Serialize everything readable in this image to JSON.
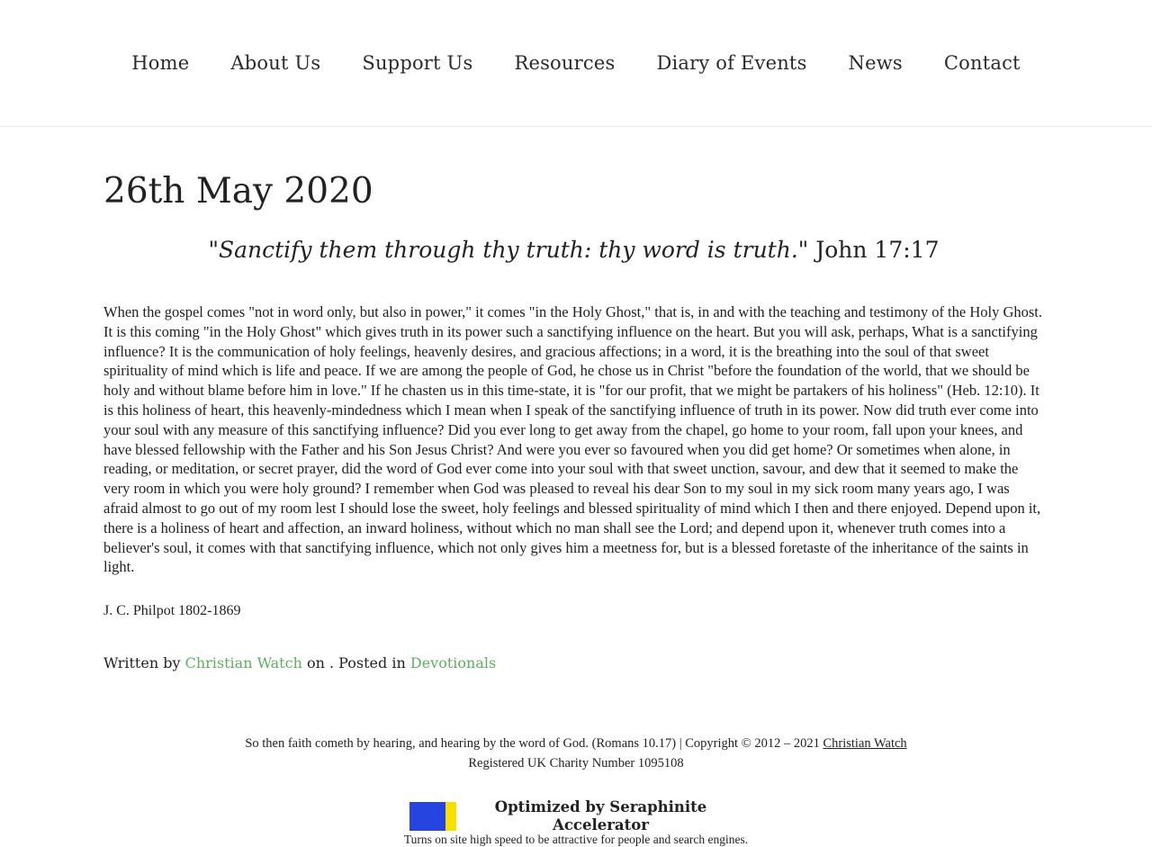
{
  "nav": {
    "items": [
      {
        "label": "Home"
      },
      {
        "label": "About Us"
      },
      {
        "label": "Support Us"
      },
      {
        "label": "Resources"
      },
      {
        "label": "Diary of Events"
      },
      {
        "label": "News"
      },
      {
        "label": "Contact"
      }
    ]
  },
  "post": {
    "title": "26th May 2020",
    "verse_quote": "\"Sanctify them through thy truth: thy word is truth.\"",
    "verse_ref": " John 17:17",
    "body": "When the gospel comes \"not in word only, but also in power,\" it comes \"in the Holy Ghost,\" that is, in and with the teaching and testimony of the Holy Ghost. It is this coming \"in the Holy Ghost\" which gives truth in its power such a sanctifying influence on the heart. But you will ask, perhaps, What is a sanctifying influence? It is the communication of holy feelings, heavenly desires, and gracious affections; in a word, it is the breathing into the soul of that sweet spirituality of mind which is life and peace. If we are among the people of God, he chose us in Christ \"before the foundation of the world, that we should be holy and without blame before him in love.\" If he chasten us in this time-state, it is \"for our profit, that we might be partakers of his holiness\" (Heb. 12:10). It is this holiness of heart, this heavenly-mindedness which I mean when I speak of the sanctifying influence of truth in its power. Now did truth ever come into your soul with any measure of this sanctifying influence? Did you ever long to get away from the chapel, go home to your room, fall upon your knees, and have blessed fellowship with the Father and his Son Jesus Christ? And were you ever so favoured when you did get home? Or sometimes when alone, in reading, or meditation, or secret prayer, did the word of God ever come into your soul with that sweet unction, savour, and dew that it seemed to make the very room in which you were holy ground? I remember when God was pleased to reveal his dear Son to my soul in my sick room many years ago, I was afraid almost to go out of my room lest I should lose the sweet, holy feelings and blessed spirituality of mind which I then and there enjoyed. Depend upon it, there is a holiness of heart and affection, an inward holiness, without which no man shall see the Lord; and depend upon it, whenever truth comes into a believer's soul, it comes with that sanctifying influence, which not only gives him a meetness for, but is a blessed foretaste of the inheritance of the saints in light.",
    "author": "J. C. Philpot 1802-1869",
    "meta": {
      "written_by": "Written by ",
      "author_link": "Christian Watch",
      "on_text": " on . Posted in ",
      "category_link": "Devotionals"
    }
  },
  "footer": {
    "line1": "So then faith cometh by hearing, and hearing by the word of God. (Romans 10.17) | Copyright © 2012 – 2021 ",
    "site_link": "Christian Watch",
    "line2": "Registered UK Charity Number 1095108"
  },
  "badge": {
    "title": "Optimized by Seraphinite Accelerator",
    "subtitle": "Turns on site high speed to be attractive for people and search engines."
  },
  "colors": {
    "link_green": "#5fae5f",
    "logo_blue": "#2645e0",
    "logo_yellow": "#f7e000"
  }
}
